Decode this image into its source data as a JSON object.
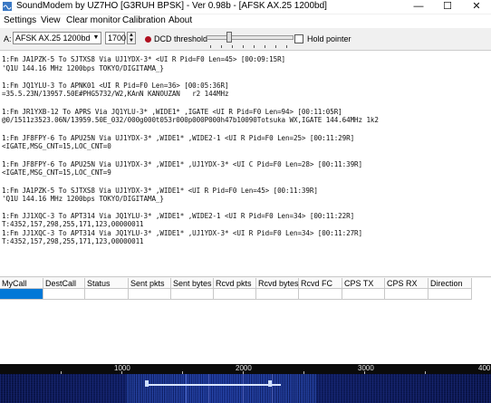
{
  "window": {
    "title": "SoundModem by UZ7HO [G3RUH BPSK] - Ver 0.98b - [AFSK AX.25 1200bd]",
    "minimize": "—",
    "maximize": "☐",
    "close": "✕"
  },
  "menu": [
    "Settings",
    "View",
    "Clear monitor",
    "Calibration",
    "About"
  ],
  "toolbar": {
    "channel": "A:",
    "mode_value": "AFSK AX.25 1200bd",
    "freq_value": "1700",
    "dcd_label": "DCD threshold",
    "hold_label": "Hold pointer"
  },
  "monitor": {
    "lines": [
      "1:Fm JA1PZK-5 To SJTXS8 Via UJ1YDX-3* <UI R Pid=F0 Len=45> [00:09:15R]",
      "'Q1U 144.16 MHz 1200bps TOKYO/DIGITAMA_}",
      "",
      "1:Fm JQ1YLU-3 To APNK01 <UI R Pid=F0 Len=36> [00:05:36R]",
      "=35.5.23N/13957.50E#PHG5732/W2,KAnN KANOUZAN   r2 144MHz",
      "",
      "1:Fm JR1YXB-12 To APRS Via JQ1YLU-3* ,WIDE1* ,IGATE <UI R Pid=F0 Len=94> [00:11:05R]",
      "@0/1511z3523.06N/13959.50E_032/000g000t053r000p000P000h47b10090Totsuka WX,IGATE 144.64MHz 1k2",
      "",
      "1:Fm JF8FPY-6 To APU25N Via UJ1YDX-3* ,WIDE1* ,WIDE2-1 <UI R Pid=F0 Len=25> [00:11:29R]",
      "<IGATE,MSG_CNT=15,LOC_CNT=0",
      "",
      "1:Fm JF8FPY-6 To APU25N Via UJ1YDX-3* ,WIDE1* ,UJ1YDX-3* <UI C Pid=F0 Len=28> [00:11:39R]",
      "<IGATE,MSG_CNT=15,LOC_CNT=9",
      "",
      "1:Fm JA1PZK-5 To SJTXS8 Via UJ1YDX-3* ,WIDE1* <UI R Pid=F0 Len=45> [00:11:39R]",
      "'Q1U 144.16 MHz 1200bps TOKYO/DIGITAMA_}",
      "",
      "1:Fm JJ1XQC-3 To APT314 Via JQ1YLU-3* ,WIDE1* ,WIDE2-1 <UI R Pid=F0 Len=34> [00:11:22R]",
      "T:4352,157,298,255,171,123,00000011",
      "1:Fm JJ1XQC-3 To APT314 Via JQ1YLU-3* ,WIDE1* ,UJ1YDX-3* <UI R Pid=F0 Len=34> [00:11:27R]",
      "T:4352,157,298,255,171,123,00000011"
    ]
  },
  "grid": {
    "columns": [
      "MyCall",
      "DestCall",
      "Status",
      "Sent pkts",
      "Sent bytes",
      "Rcvd pkts",
      "Rcvd bytes",
      "Rcvd FC",
      "CPS TX",
      "CPS RX",
      "Direction"
    ]
  },
  "waterfall": {
    "scale_labels": [
      "1000",
      "2000",
      "3000",
      "400"
    ]
  }
}
